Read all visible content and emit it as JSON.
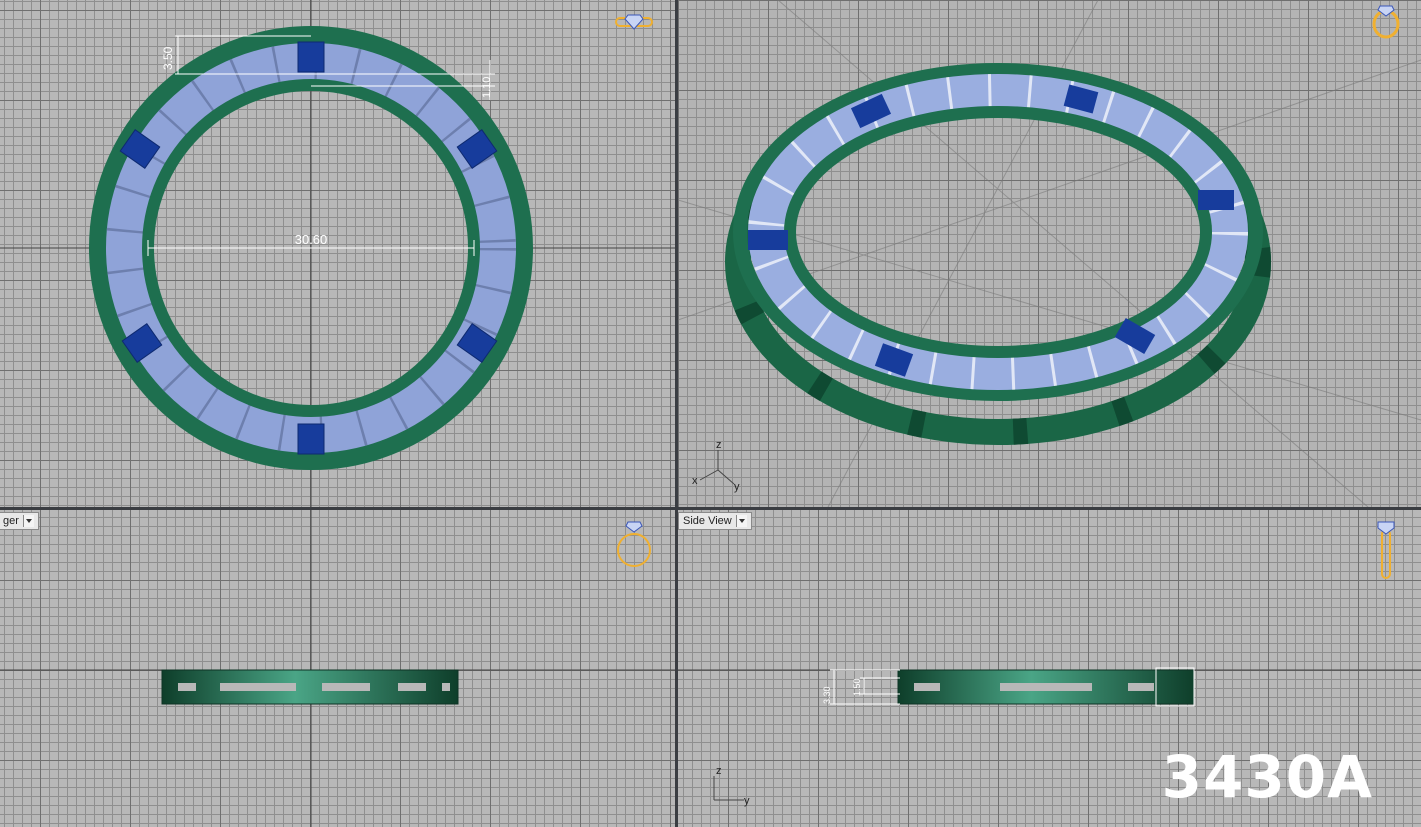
{
  "viewports": {
    "top": {
      "dims": {
        "thickness": "3.50",
        "width": "1.10",
        "inner_diameter": "30.60"
      }
    },
    "perspective": {
      "axes": {
        "z": "z",
        "x": "x",
        "y": "y"
      }
    },
    "front": {
      "label": "ger"
    },
    "side": {
      "label": "Side View",
      "dims": {
        "height": "3.30",
        "inner": "1.50"
      },
      "axes": {
        "z": "z",
        "y": "y"
      }
    }
  },
  "model_code": "3430A",
  "colors": {
    "metal": "#1e6f4f",
    "stone_light": "#9aaee0",
    "stone_dark": "#173c9c",
    "gizmo": "#f0b030",
    "grid_major": "#6f6f6f",
    "grid_minor": "#8f8f8f"
  },
  "icons": [
    "gem-view-icon",
    "ring-front-icon",
    "ring-side-icon",
    "ring-perspective-icon"
  ]
}
